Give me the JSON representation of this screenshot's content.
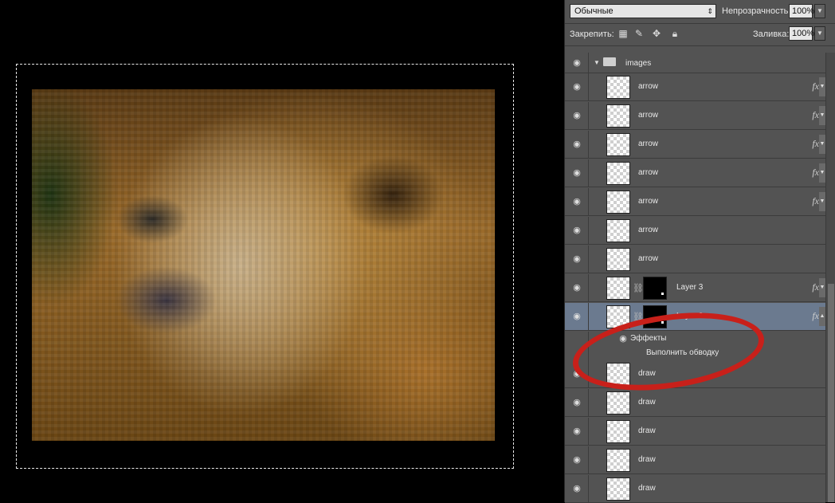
{
  "toolbar": {
    "blend_mode": "Обычные",
    "opacity_label": "Непрозрачность:",
    "opacity_value": "100%",
    "lock_label": "Закрепить:",
    "fill_label": "Заливка:",
    "fill_value": "100%"
  },
  "group": {
    "name": "images"
  },
  "layers": [
    {
      "name": "arrow",
      "fx": "fx"
    },
    {
      "name": "arrow",
      "fx": "fx"
    },
    {
      "name": "arrow",
      "fx": "fx"
    },
    {
      "name": "arrow",
      "fx": "fx"
    },
    {
      "name": "arrow",
      "fx": "fx"
    },
    {
      "name": "arrow"
    },
    {
      "name": "arrow"
    },
    {
      "name": "Layer 3",
      "fx": "fx"
    },
    {
      "name": "Layer 2",
      "fx": "fx"
    }
  ],
  "effects": {
    "title": "Эффекты",
    "stroke": "Выполнить обводку"
  },
  "draw_layers": [
    {
      "name": "draw"
    },
    {
      "name": "draw"
    },
    {
      "name": "draw"
    },
    {
      "name": "draw"
    },
    {
      "name": "draw"
    }
  ],
  "colors": {
    "panel": "#535353",
    "selected": "#6b7a8f",
    "annotation": "#c8201a"
  }
}
